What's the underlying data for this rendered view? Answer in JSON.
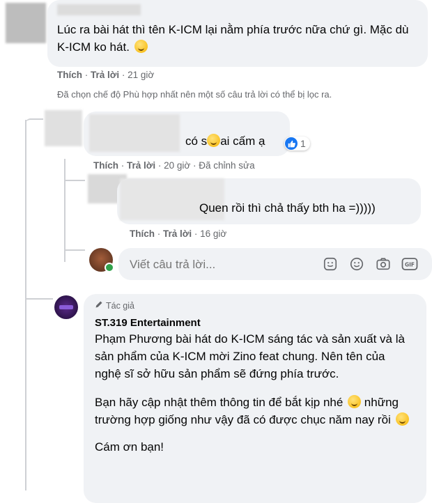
{
  "comment1": {
    "text": "Lúc ra bài hát thì tên K-ICM lại nằm phía trước nữa chứ gì. Mặc dù K-ICM ko hát.",
    "like": "Thích",
    "reply": "Trả lời",
    "time": "21 giờ",
    "filter_notice": "Đã chọn chế độ Phù hợp nhất nên một số câu trả lời có thể bị lọc ra."
  },
  "reply1": {
    "text_before": "có s",
    "text_after": "ai cấm ạ",
    "reaction_count": "1",
    "like": "Thích",
    "reply": "Trả lời",
    "time": "20 giờ",
    "edited": "Đã chỉnh sửa"
  },
  "reply2": {
    "text": "Quen rồi thì chả thấy bth ha =)))))",
    "like": "Thích",
    "reply": "Trả lời",
    "time": "16 giờ"
  },
  "reply_input": {
    "placeholder": "Viết câu trả lời...",
    "icons": [
      "sticker-icon",
      "emoji-icon",
      "camera-icon",
      "gif-icon"
    ]
  },
  "author_reply": {
    "badge": "Tác giả",
    "name": "ST.319 Entertainment",
    "para1": "Phạm Phương bài hát do K-ICM sáng tác và sản xuất và là sản phẩm của K-ICM mời Zino feat chung. Nên tên của nghệ sĩ sở hữu sản phẩm sẽ đứng phía trước.",
    "para2_a": "Bạn hãy cập nhật thêm thông tin để bắt kịp nhé",
    "para2_b": "những trường hợp giống như vậy đã có được chục năm nay rồi",
    "para3": "Cám ơn bạn!"
  },
  "colors": {
    "bubble": "#f0f2f5",
    "meta": "#65676b",
    "like_blue": "#1877f2",
    "online_green": "#31a24c"
  }
}
